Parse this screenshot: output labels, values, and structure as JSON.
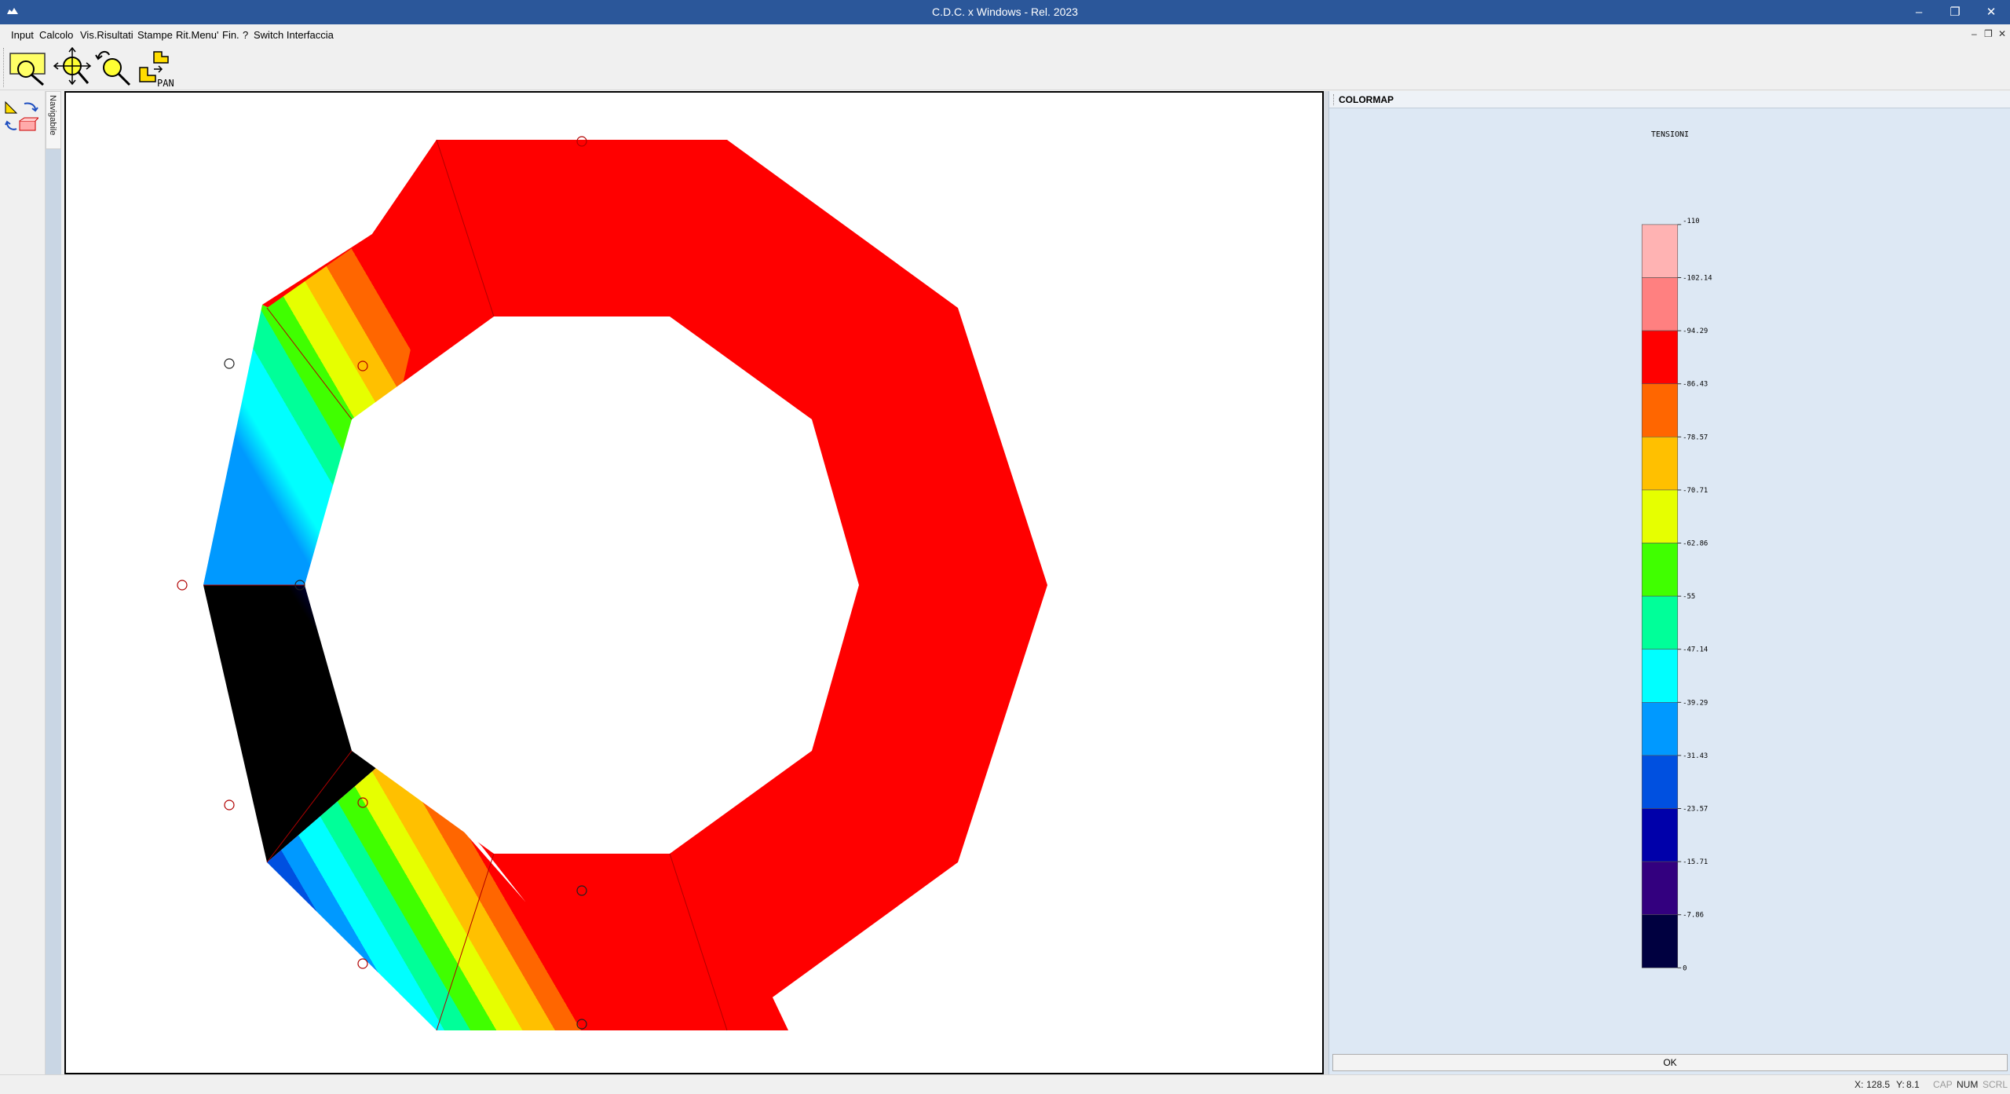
{
  "window": {
    "title": "C.D.C. x Windows - Rel. 2023",
    "minimize": "–",
    "restore": "❐",
    "close": "✕"
  },
  "menu": {
    "items": [
      "Input",
      "Calcolo",
      "Vis.Risultati",
      "Stampe",
      "Rit.Menu'",
      "Fin.",
      "?",
      "Switch Interfaccia"
    ],
    "mdi_minimize": "–",
    "mdi_restore": "❐",
    "mdi_close": "✕"
  },
  "toolbar": {
    "tools": [
      {
        "name": "zoom-window-icon"
      },
      {
        "name": "zoom-extents-icon"
      },
      {
        "name": "zoom-previous-icon"
      },
      {
        "name": "pan-icon",
        "label": "PAN"
      }
    ]
  },
  "left_panel": {
    "nav_tab_label": "Navigabile"
  },
  "colormap": {
    "header": "COLORMAP",
    "title": "TENSIONI",
    "labels": [
      "-110",
      "-102.14",
      "-94.29",
      "-86.43",
      "-78.57",
      "-70.71",
      "-62.86",
      "-55",
      "-47.14",
      "-39.29",
      "-31.43",
      "-23.57",
      "-15.71",
      "-7.86",
      "0"
    ],
    "colors": [
      "#ffb3b3",
      "#ff8080",
      "#ff0000",
      "#ff6600",
      "#ffc000",
      "#e6ff00",
      "#40ff00",
      "#00ff99",
      "#00ffff",
      "#0099ff",
      "#0050e0",
      "#0000aa",
      "#33007f",
      "#000040"
    ],
    "ok_label": "OK"
  },
  "colors": {
    "titlebar": "#2b579a",
    "panel": "#dde8f4"
  },
  "status": {
    "x_label": "X:",
    "x_value": "128.5",
    "y_label": "Y:",
    "y_value": "8.1",
    "cap": "CAP",
    "num": "NUM",
    "scrl": "SCRL"
  }
}
